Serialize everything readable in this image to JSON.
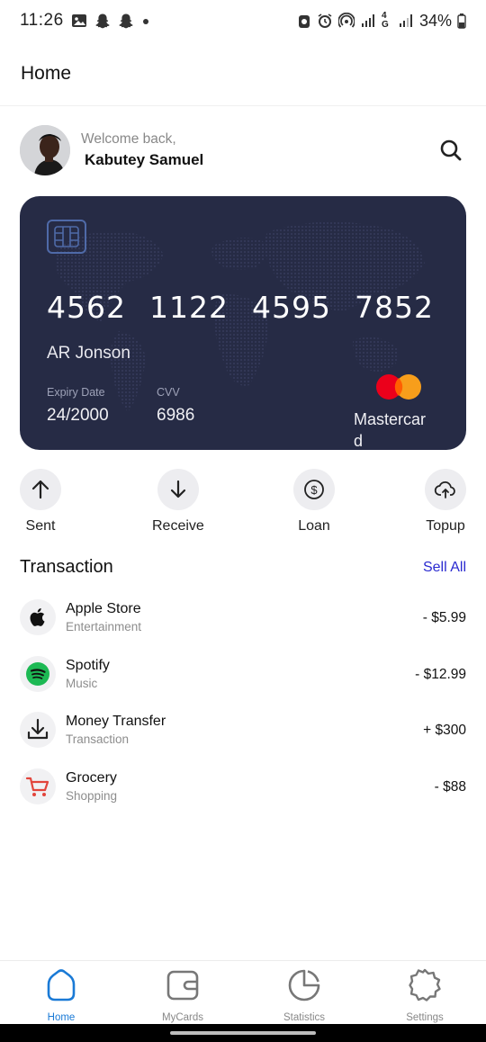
{
  "status_bar": {
    "time": "11:26",
    "battery": "34%",
    "network": "4G"
  },
  "header": {
    "title": "Home"
  },
  "profile": {
    "greeting": "Welcome back,",
    "name": "Kabutey Samuel"
  },
  "card": {
    "number_groups": [
      "4562",
      "1122",
      "4595",
      "7852"
    ],
    "holder": "AR Jonson",
    "expiry_label": "Expiry Date",
    "expiry_value": "24/2000",
    "cvv_label": "CVV",
    "cvv_value": "6986",
    "brand": "Mastercard",
    "background_color": "#262b45"
  },
  "actions": [
    {
      "label": "Sent",
      "icon": "arrow-up-icon"
    },
    {
      "label": "Receive",
      "icon": "arrow-down-icon"
    },
    {
      "label": "Loan",
      "icon": "dollar-icon"
    },
    {
      "label": "Topup",
      "icon": "cloud-upload-icon"
    }
  ],
  "transactions": {
    "title": "Transaction",
    "see_all": "Sell All",
    "items": [
      {
        "name": "Apple Store",
        "category": "Entertainment",
        "amount": "- $5.99",
        "icon": "apple-icon"
      },
      {
        "name": "Spotify",
        "category": "Music",
        "amount": "- $12.99",
        "icon": "spotify-icon"
      },
      {
        "name": "Money Transfer",
        "category": "Transaction",
        "amount": "+ $300",
        "icon": "download-icon"
      },
      {
        "name": "Grocery",
        "category": "Shopping",
        "amount": "- $88",
        "icon": "cart-icon"
      }
    ]
  },
  "bottom_nav": {
    "items": [
      {
        "label": "Home",
        "icon": "home-icon",
        "active": true
      },
      {
        "label": "MyCards",
        "icon": "wallet-icon",
        "active": false
      },
      {
        "label": "Statistics",
        "icon": "pie-chart-icon",
        "active": false
      },
      {
        "label": "Settings",
        "icon": "gear-icon",
        "active": false
      }
    ],
    "active_color": "#1a7ad6"
  }
}
